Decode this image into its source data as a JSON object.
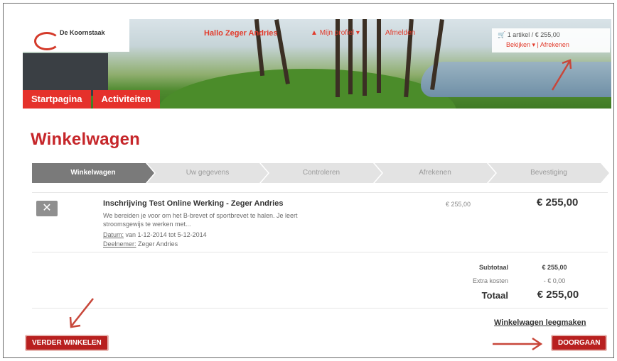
{
  "header": {
    "logo_text": "De Koornstaak",
    "greeting": "Hallo Zeger Andries",
    "account_label": "Mijn profiel ▾",
    "logout_label": "Afmelden",
    "cart_summary": "1 artikel / € 255,00",
    "cart_actions": "Bekijken ▾  |  Afrekenen"
  },
  "nav": {
    "tabs": [
      "Startpagina",
      "Activiteiten"
    ]
  },
  "page": {
    "title": "Winkelwagen"
  },
  "steps": [
    "Winkelwagen",
    "Uw gegevens",
    "Controleren",
    "Afrekenen",
    "Bevestiging"
  ],
  "cart": {
    "item": {
      "title": "Inschrijving Test Online Werking - Zeger Andries",
      "description": "We bereiden je voor om het B-brevet of sportbrevet te halen. Je leert stroomsgewijs te werken met...",
      "date_label": "Datum:",
      "date_value": "van 1-12-2014 tot 5-12-2014",
      "participant_label": "Deelnemer:",
      "participant_value": "Zeger Andries",
      "unit_price": "€ 255,00",
      "total": "€ 255,00",
      "remove_icon": "close-icon"
    },
    "summary": {
      "subtotal_label": "Subtotaal",
      "subtotal_value": "€ 255,00",
      "extra_label": "Extra kosten",
      "extra_value": "- € 0,00",
      "total_label": "Totaal",
      "total_value": "€ 255,00"
    },
    "clear_label": "Winkelwagen leegmaken"
  },
  "buttons": {
    "continue_shopping": "VERDER WINKELEN",
    "proceed": "DOORGAAN"
  },
  "colors": {
    "brand_red": "#e5312b",
    "title_red": "#c6262a",
    "button_red": "#b8201f",
    "annotation_arrow": "#c8473a"
  }
}
